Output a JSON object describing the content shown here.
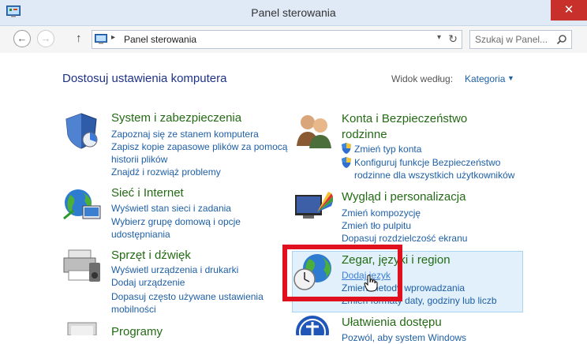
{
  "window": {
    "title": "Panel sterowania",
    "close_label": "✕"
  },
  "nav": {
    "back": "←",
    "forward": "→",
    "up": "↑",
    "address_sep": "▸",
    "address": "Panel sterowania",
    "address_dropdown": "▾",
    "refresh": "↻",
    "search_placeholder": "Szukaj w Panel..."
  },
  "header": {
    "title": "Dostosuj ustawienia komputera",
    "view_label": "Widok według:",
    "view_value": "Kategoria",
    "view_arrow": "▼"
  },
  "categories": [
    {
      "title": "System i zabezpieczenia",
      "links": [
        "Zapoznaj się ze stanem komputera",
        "Zapisz kopie zapasowe plików za pomocą historii plików",
        "Znajdź i rozwiąż problemy"
      ]
    },
    {
      "title": "Konta i Bezpieczeństwo rodzinne",
      "links": [
        "Zmień typ konta",
        "Konfiguruj funkcje Bezpieczeństwo rodzinne dla wszystkich użytkowników"
      ]
    },
    {
      "title": "Sieć i Internet",
      "links": [
        "Wyświetl stan sieci i zadania",
        "Wybierz grupę domową i opcje udostępniania"
      ]
    },
    {
      "title": "Wygląd i personalizacja",
      "links": [
        "Zmień kompozycję",
        "Zmień tło pulpitu",
        "Dopasuj rozdzielczość ekranu"
      ]
    },
    {
      "title": "Sprzęt i dźwięk",
      "links": [
        "Wyświetl urządzenia i drukarki",
        "Dodaj urządzenie",
        "Dopasuj często używane ustawienia mobilności"
      ]
    },
    {
      "title": "Zegar, języki i region",
      "links": [
        "Dodaj język",
        "Zmień metody wprowadzania",
        "Zmień formaty daty, godziny lub liczb"
      ]
    },
    {
      "title": "Programy",
      "links": []
    },
    {
      "title": "Ułatwienia dostępu",
      "links": [
        "Pozwól, aby system Windows"
      ]
    }
  ]
}
